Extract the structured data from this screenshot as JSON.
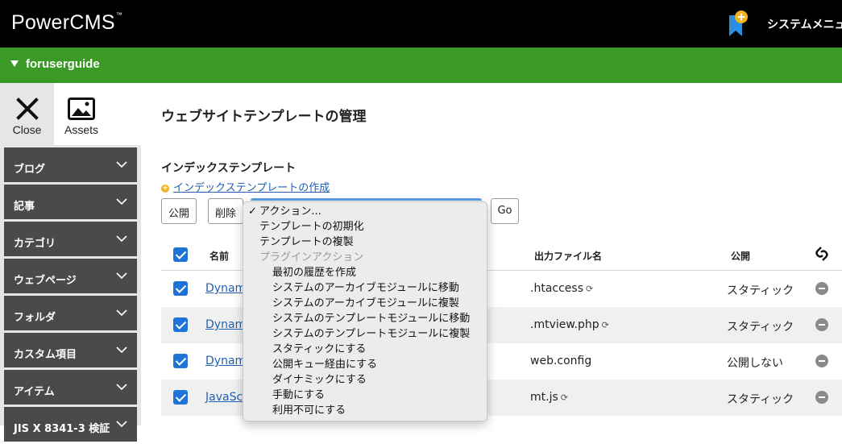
{
  "header": {
    "logo": "PowerCMS",
    "logo_tm": "™",
    "system_menu": "システムメニュー"
  },
  "site": {
    "name": "foruserguide"
  },
  "panel": {
    "close_label": "Close",
    "assets_label": "Assets"
  },
  "sidebar": {
    "items": [
      {
        "label": "ブログ"
      },
      {
        "label": "記事"
      },
      {
        "label": "カテゴリ"
      },
      {
        "label": "ウェブページ"
      },
      {
        "label": "フォルダ"
      },
      {
        "label": "カスタム項目"
      },
      {
        "label": "アイテム"
      },
      {
        "label": "JIS X 8341-3 検証"
      }
    ]
  },
  "page": {
    "title": "ウェブサイトテンプレートの管理",
    "section_title": "インデックステンプレート",
    "create_link": "インデックステンプレートの作成"
  },
  "toolbar": {
    "publish": "公開",
    "delete": "削除",
    "go": "Go"
  },
  "table": {
    "headers": {
      "name": "名前",
      "output": "出力ファイル名",
      "publish": "公開"
    },
    "rows": [
      {
        "name": "Dynami",
        "output": ".htaccess",
        "publish": "スタティック",
        "sync": true
      },
      {
        "name": "Dynami",
        "output": ".mtview.php",
        "publish": "スタティック",
        "sync": true
      },
      {
        "name": "Dynami",
        "output": "web.config",
        "publish": "公開しない",
        "sync": false
      },
      {
        "name": "JavaSc",
        "output": "mt.js",
        "publish": "スタティック",
        "sync": true
      }
    ]
  },
  "action_menu": {
    "check": "✓",
    "items": [
      {
        "label": "アクション...",
        "level": 1,
        "selected": true
      },
      {
        "label": "テンプレートの初期化",
        "level": 1
      },
      {
        "label": "テンプレートの複製",
        "level": 1
      },
      {
        "label": "プラグインアクション",
        "level": 1,
        "disabled": true
      },
      {
        "label": "最初の履歴を作成",
        "level": 2
      },
      {
        "label": "システムのアーカイブモジュールに移動",
        "level": 2
      },
      {
        "label": "システムのアーカイブモジュールに複製",
        "level": 2
      },
      {
        "label": "システムのテンプレートモジュールに移動",
        "level": 2
      },
      {
        "label": "システムのテンプレートモジュールに複製",
        "level": 2
      },
      {
        "label": "スタティックにする",
        "level": 2
      },
      {
        "label": "公開キュー経由にする",
        "level": 2
      },
      {
        "label": "ダイナミックにする",
        "level": 2
      },
      {
        "label": "手動にする",
        "level": 2
      },
      {
        "label": "利用不可にする",
        "level": 2
      }
    ]
  },
  "colors": {
    "topbar": "#000000",
    "sitebar": "#3a9a25",
    "nav_bg": "#4a4a4a",
    "link": "#1f5fb4",
    "checkbox": "#1d74d6",
    "bookmark": "#2a8fe0",
    "bookmark_badge": "#f2b220"
  }
}
